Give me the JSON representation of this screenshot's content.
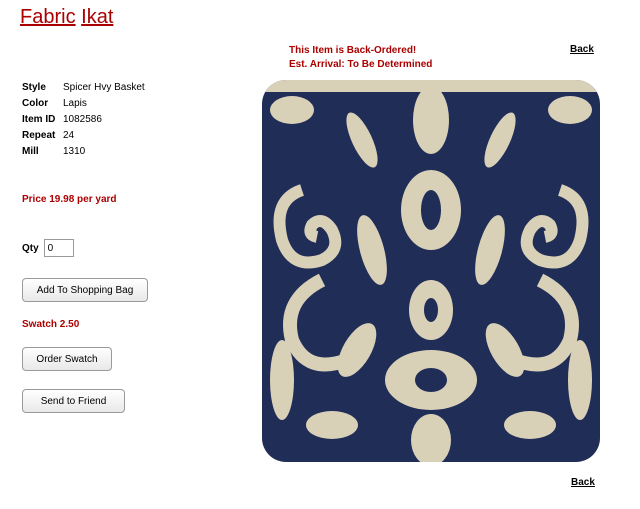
{
  "header": {
    "title_word1": "Fabric",
    "title_word2": "Ikat"
  },
  "notice": {
    "line1": "This Item is Back-Ordered!",
    "line2": "Est. Arrival: To Be Determined"
  },
  "nav": {
    "back_top": "Back",
    "back_bottom": "Back"
  },
  "specs": [
    {
      "label": "Style",
      "value": "Spicer Hvy Basket"
    },
    {
      "label": "Color",
      "value": "Lapis"
    },
    {
      "label": "Item ID",
      "value": "1082586"
    },
    {
      "label": "Repeat",
      "value": "24"
    },
    {
      "label": "Mill",
      "value": "1310"
    }
  ],
  "price": {
    "text": "Price 19.98 per yard"
  },
  "qty": {
    "label": "Qty",
    "value": "0"
  },
  "actions": {
    "add_to_bag": "Add To Shopping Bag",
    "swatch_price": "Swatch 2.50",
    "order_swatch": "Order Swatch",
    "send_to_friend": "Send to Friend"
  },
  "image": {
    "pattern": "ikat-damask",
    "ink_color": "#1f2d57",
    "ground_color": "#d9d0b8"
  }
}
